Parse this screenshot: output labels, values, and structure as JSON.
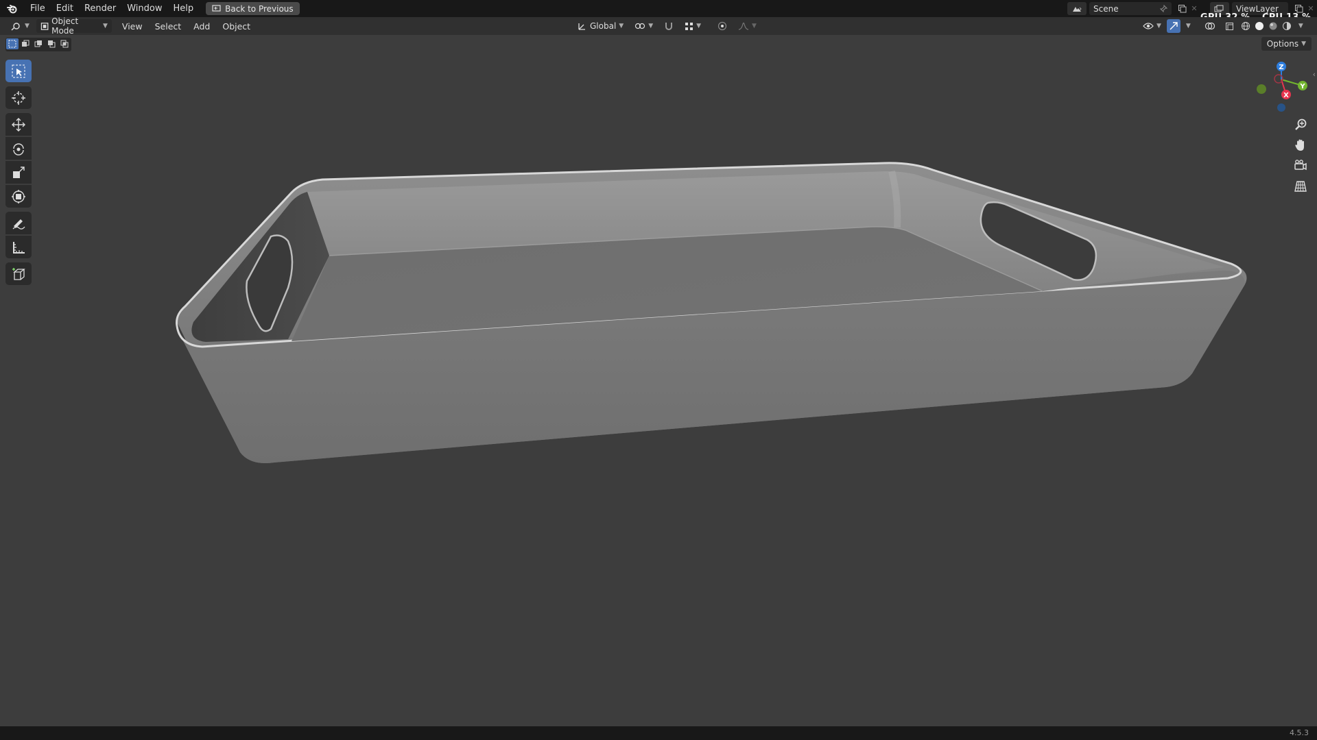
{
  "menu": {
    "items": [
      "File",
      "Edit",
      "Render",
      "Window",
      "Help"
    ],
    "back_button": "Back to Previous"
  },
  "scene": {
    "name": "Scene"
  },
  "view_layer": {
    "name": "ViewLayer"
  },
  "stats": {
    "gpu": "GPU 32 %",
    "cpu": "CPU 13 %"
  },
  "viewport_header": {
    "mode": "Object Mode",
    "menus": [
      "View",
      "Select",
      "Add",
      "Object"
    ],
    "transform_orientation": "Global"
  },
  "options_label": "Options",
  "gizmo": {
    "z": "Z",
    "y": "Y",
    "x": "X"
  },
  "tools": [
    "Select Box",
    "Cursor",
    "Move",
    "Rotate",
    "Scale",
    "Transform",
    "Annotate",
    "Measure",
    "Add Cube"
  ],
  "version": "4.5.3",
  "colors": {
    "accent": "#4772b3",
    "axis_x": "#e8344e",
    "axis_y": "#72b52f",
    "axis_z": "#2e7ede",
    "viewport_bg": "#3d3d3d"
  }
}
